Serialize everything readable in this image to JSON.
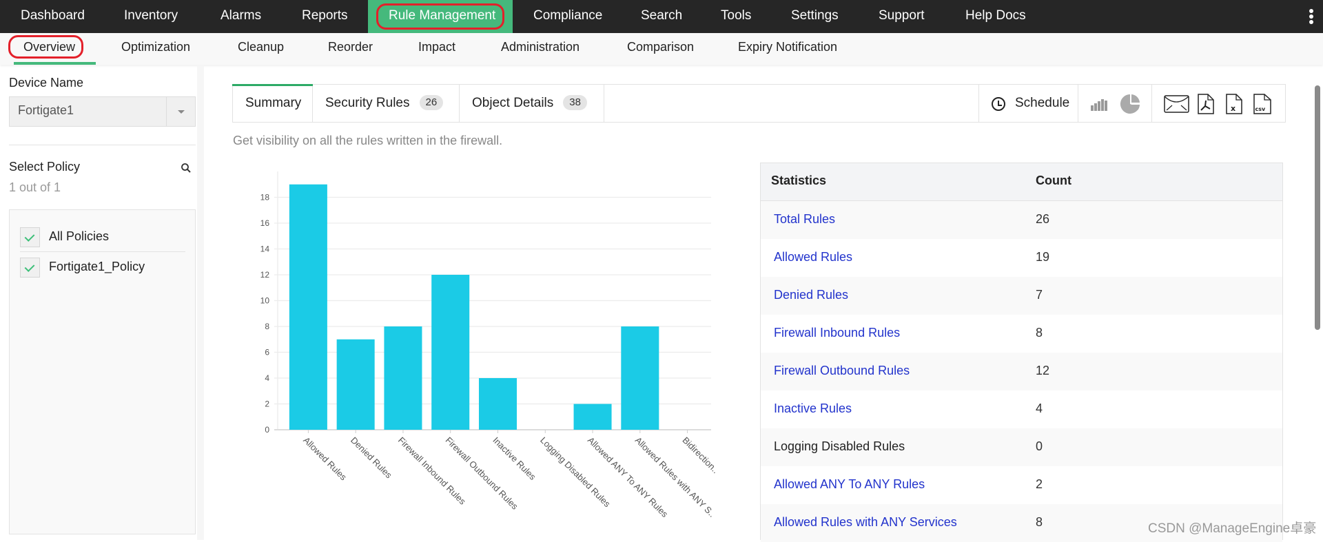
{
  "topnav": {
    "items": [
      {
        "label": "Dashboard"
      },
      {
        "label": "Inventory"
      },
      {
        "label": "Alarms"
      },
      {
        "label": "Reports"
      },
      {
        "label": "Rule Management",
        "active": true
      },
      {
        "label": "Compliance"
      },
      {
        "label": "Search"
      },
      {
        "label": "Tools"
      },
      {
        "label": "Settings"
      },
      {
        "label": "Support"
      },
      {
        "label": "Help Docs"
      }
    ],
    "more_icon": "vertical-ellipsis-icon"
  },
  "subnav": {
    "items": [
      {
        "label": "Overview",
        "active": true
      },
      {
        "label": "Optimization"
      },
      {
        "label": "Cleanup"
      },
      {
        "label": "Reorder"
      },
      {
        "label": "Impact"
      },
      {
        "label": "Administration"
      },
      {
        "label": "Comparison"
      },
      {
        "label": "Expiry Notification"
      }
    ]
  },
  "sidebar": {
    "device_label": "Device Name",
    "device_value": "Fortigate1",
    "policy_label": "Select Policy",
    "policy_count": "1 out of 1",
    "policies": [
      {
        "label": "All Policies",
        "checked": true
      },
      {
        "label": "Fortigate1_Policy",
        "checked": true
      }
    ]
  },
  "tabs": [
    {
      "label": "Summary",
      "active": true
    },
    {
      "label": "Security Rules",
      "badge": "26"
    },
    {
      "label": "Object Details",
      "badge": "38"
    }
  ],
  "toolbar": {
    "schedule_label": "Schedule",
    "view_icons": [
      "bar-chart-icon",
      "pie-chart-icon"
    ],
    "export_icons": [
      "email-icon",
      "pdf-icon",
      "excel-icon",
      "csv-icon"
    ]
  },
  "hint": "Get visibility on all the rules written in the firewall.",
  "colors": {
    "accent": "#45b97c",
    "bar": "#1bcbe6",
    "link": "#2233cc",
    "highlight_ring": "#e3202a"
  },
  "chart_data": {
    "type": "bar",
    "title": "",
    "xlabel": "",
    "ylabel": "",
    "categories": [
      "Allowed Rules",
      "Denied Rules",
      "Firewall Inbound Rules",
      "Firewall Outbound Rules",
      "Inactive Rules",
      "Logging Disabled Rules",
      "Allowed ANY To ANY Rules",
      "Allowed Rules with ANY S..",
      "Bidirection.."
    ],
    "values": [
      19,
      7,
      8,
      12,
      4,
      0,
      2,
      8,
      0
    ],
    "ylim": [
      0,
      20
    ],
    "yticks": [
      0,
      2,
      4,
      6,
      8,
      10,
      12,
      14,
      16,
      18
    ],
    "grid": true,
    "legend": "none"
  },
  "stats": {
    "headers": [
      "Statistics",
      "Count"
    ],
    "rows": [
      {
        "name": "Total Rules",
        "count": "26",
        "link": true
      },
      {
        "name": "Allowed Rules",
        "count": "19",
        "link": true
      },
      {
        "name": "Denied Rules",
        "count": "7",
        "link": true
      },
      {
        "name": "Firewall Inbound Rules",
        "count": "8",
        "link": true
      },
      {
        "name": "Firewall Outbound Rules",
        "count": "12",
        "link": true
      },
      {
        "name": "Inactive Rules",
        "count": "4",
        "link": true
      },
      {
        "name": "Logging Disabled Rules",
        "count": "0",
        "link": false
      },
      {
        "name": "Allowed ANY To ANY Rules",
        "count": "2",
        "link": true
      },
      {
        "name": "Allowed Rules with ANY Services",
        "count": "8",
        "link": true
      }
    ]
  },
  "watermark": "CSDN @ManageEngine卓豪"
}
